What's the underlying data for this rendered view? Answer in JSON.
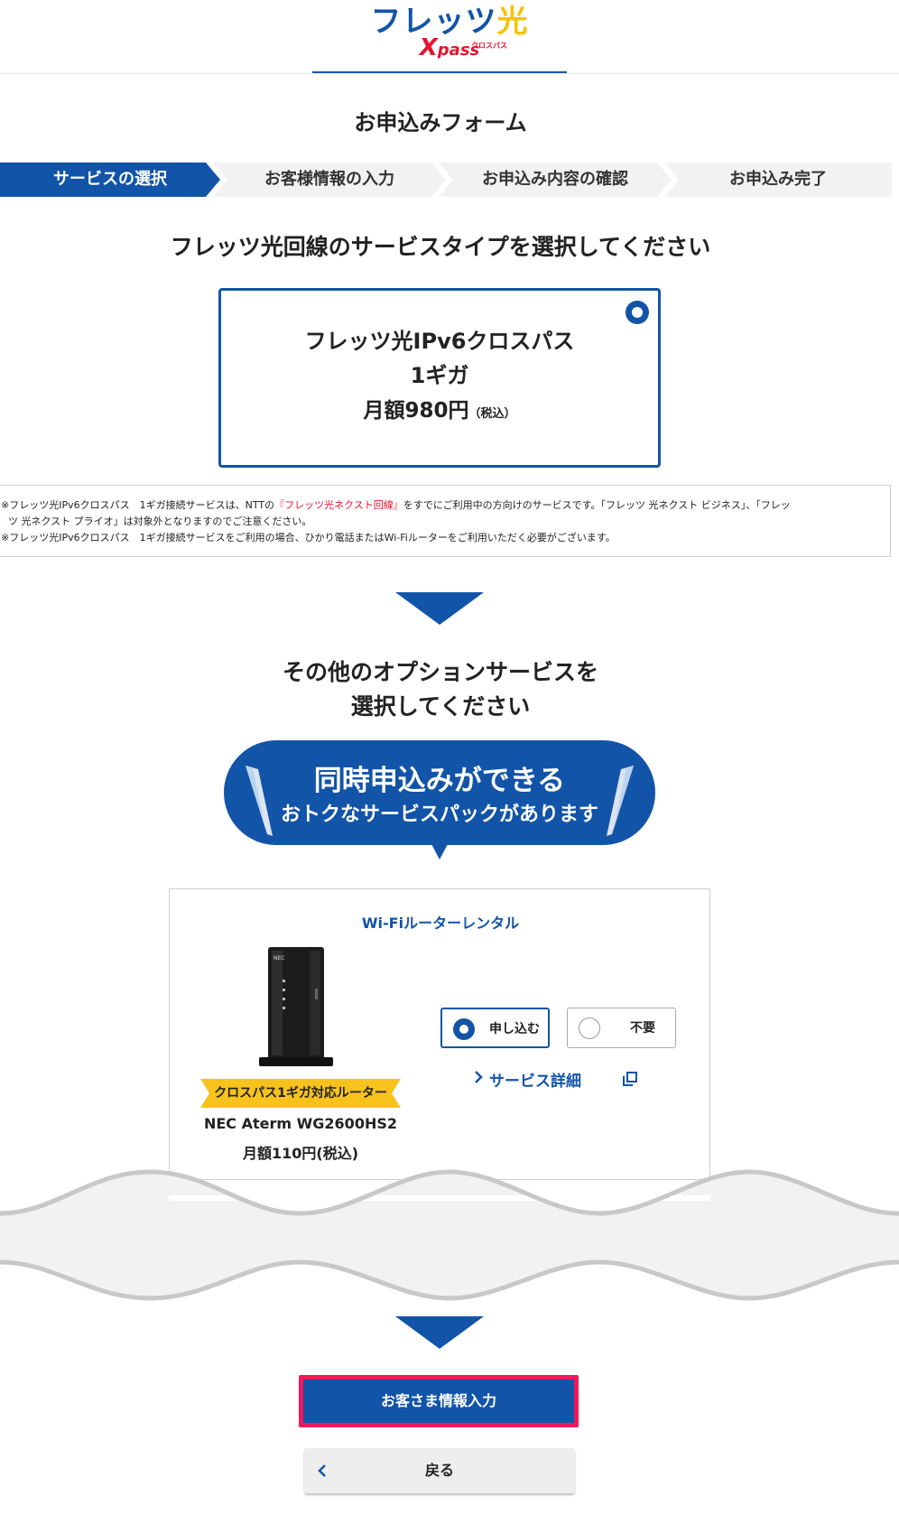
{
  "header": {
    "logo_main": "フレッツ",
    "logo_hikari": "光",
    "logo_sub_x": "X",
    "logo_sub": "pass",
    "logo_sub_kana": "クロスパス"
  },
  "form_title": "お申込みフォーム",
  "steps": [
    {
      "label": "サービスの選択",
      "active": true
    },
    {
      "label": "お客様情報の入力",
      "active": false
    },
    {
      "label": "お申込み内容の確認",
      "active": false
    },
    {
      "label": "お申込み完了",
      "active": false
    }
  ],
  "service_section": {
    "title": "フレッツ光回線のサービスタイプを選択してください",
    "plan_name": "フレッツ光IPv6クロスパス",
    "plan_speed": "1ギガ",
    "plan_price": "月額980円",
    "plan_tax": "（税込）"
  },
  "notes": {
    "line1_a": "※フレッツ光IPv6クロスパス　1ギガ接続サービスは、NTTの",
    "line1_link": "『フレッツ光ネクスト回線』",
    "line1_b": "をすでにご利用中の方向けのサービスです。「フレッツ 光ネクスト ビジネス」、「フレッ",
    "line2": "ツ 光ネクスト プライオ」は対象外となりますのでご注意ください。",
    "line3": "※フレッツ光IPv6クロスパス　1ギガ接続サービスをご利用の場合、ひかり電話またはWi-Fiルーターをご利用いただく必要がございます。"
  },
  "option_section": {
    "title_line1": "その他のオプションサービスを",
    "title_line2": "選択してください",
    "bubble_line1": "同時申込みができる",
    "bubble_line2": "おトクなサービスパックがあります"
  },
  "wifi_option": {
    "title": "Wi-Fiルーターレンタル",
    "badge": "クロスパス1ギガ対応ルーター",
    "model": "NEC Aterm WG2600HS2",
    "price": "月額110円(税込)",
    "router_brand": "NEC",
    "choice_apply": "申し込む",
    "choice_none": "不要",
    "selected": "申し込む",
    "detail_link": "サービス詳細"
  },
  "buttons": {
    "next": "お客さま情報入力",
    "back": "戻る"
  },
  "colors": {
    "brand_blue": "#1254a8",
    "accent_yellow": "#f5c400",
    "accent_red": "#e8132e",
    "highlight_pink": "#f0185a"
  }
}
